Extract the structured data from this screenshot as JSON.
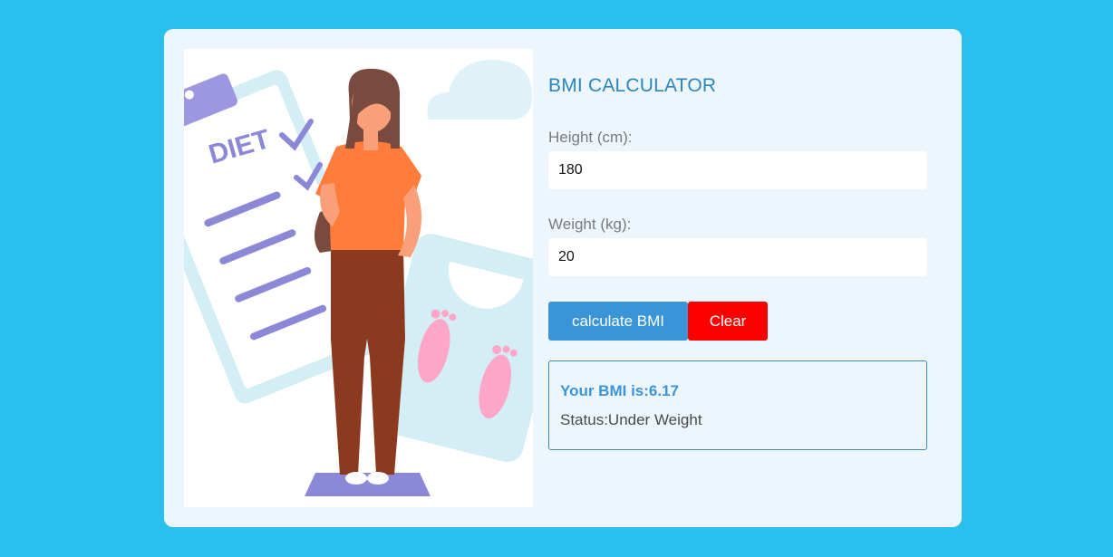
{
  "illustration": {
    "icon": "woman-weighing-illustration",
    "clipboard_text": "DIET"
  },
  "calculator": {
    "title": "BMI CALCULATOR",
    "height_label": "Height (cm):",
    "height_value": "180",
    "weight_label": "Weight (kg):",
    "weight_value": "20",
    "calculate_label": "calculate BMI",
    "clear_label": "Clear"
  },
  "result": {
    "bmi_text": "Your BMI is:6.17",
    "status_text": "Status:Under Weight"
  },
  "colors": {
    "background": "#2bbfed",
    "card": "#eef6fd",
    "title": "#2a86c0",
    "calculate_button": "#3a95d8",
    "clear_button": "#fc0000",
    "result_border": "#3a89c3"
  }
}
